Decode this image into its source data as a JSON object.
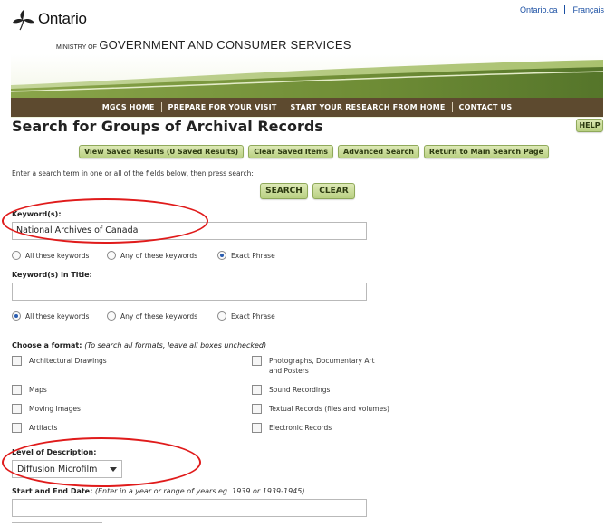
{
  "header": {
    "logo_text": "Ontario",
    "links": [
      "Ontario.ca",
      "Français"
    ],
    "ministry_prefix": "MINISTRY OF",
    "ministry_name": "GOVERNMENT AND CONSUMER SERVICES"
  },
  "nav": {
    "items": [
      "MGCS HOME",
      "PREPARE FOR YOUR VISIT",
      "START YOUR RESEARCH FROM HOME",
      "CONTACT US"
    ]
  },
  "page": {
    "title": "Search for Groups of Archival Records",
    "help_label": "HELP",
    "instructions": "Enter a search term in one or all of the fields below, then press search:"
  },
  "actions": {
    "buttons": [
      "View Saved Results (0 Saved Results)",
      "Clear Saved Items",
      "Advanced Search",
      "Return to Main Search Page"
    ],
    "search_label": "SEARCH",
    "clear_label": "CLEAR"
  },
  "keywords": {
    "label": "Keyword(s):",
    "value": "National Archives of Canada",
    "options": [
      "All these keywords",
      "Any of these keywords",
      "Exact Phrase"
    ],
    "selected": "Exact Phrase"
  },
  "title_keywords": {
    "label": "Keyword(s) in Title:",
    "value": "",
    "options": [
      "All these keywords",
      "Any of these keywords",
      "Exact Phrase"
    ],
    "selected": "All these keywords"
  },
  "format": {
    "label": "Choose a format:",
    "hint": "(To search all formats, leave all boxes unchecked)",
    "left": [
      "Architectural Drawings",
      "Maps",
      "Moving Images",
      "Artifacts"
    ],
    "right": [
      "Photographs, Documentary Art",
      "and Posters",
      "Sound Recordings",
      "Textual Records (files and volumes)",
      "Electronic Records"
    ]
  },
  "level": {
    "label": "Level of Description:",
    "selected": "Diffusion Microfilm"
  },
  "dates": {
    "label": "Start and End Date:",
    "hint": "(Enter in a year or range of years eg. 1939 or 1939-1945)",
    "value": ""
  },
  "colors": {
    "nav_bg": "#5d4a2f",
    "button_green": "#c8dc96",
    "annotation_red": "#e01b1b",
    "link_blue": "#1a4fa3"
  }
}
